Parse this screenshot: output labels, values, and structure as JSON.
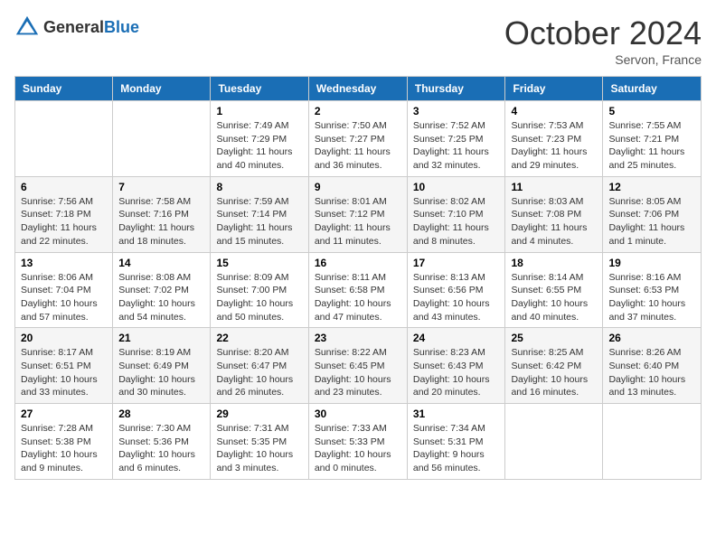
{
  "header": {
    "logo": {
      "text_general": "General",
      "text_blue": "Blue"
    },
    "title": "October 2024",
    "subtitle": "Servon, France"
  },
  "weekdays": [
    "Sunday",
    "Monday",
    "Tuesday",
    "Wednesday",
    "Thursday",
    "Friday",
    "Saturday"
  ],
  "weeks": [
    [
      {
        "day": "",
        "sunrise": "",
        "sunset": "",
        "daylight": ""
      },
      {
        "day": "",
        "sunrise": "",
        "sunset": "",
        "daylight": ""
      },
      {
        "day": "1",
        "sunrise": "Sunrise: 7:49 AM",
        "sunset": "Sunset: 7:29 PM",
        "daylight": "Daylight: 11 hours and 40 minutes."
      },
      {
        "day": "2",
        "sunrise": "Sunrise: 7:50 AM",
        "sunset": "Sunset: 7:27 PM",
        "daylight": "Daylight: 11 hours and 36 minutes."
      },
      {
        "day": "3",
        "sunrise": "Sunrise: 7:52 AM",
        "sunset": "Sunset: 7:25 PM",
        "daylight": "Daylight: 11 hours and 32 minutes."
      },
      {
        "day": "4",
        "sunrise": "Sunrise: 7:53 AM",
        "sunset": "Sunset: 7:23 PM",
        "daylight": "Daylight: 11 hours and 29 minutes."
      },
      {
        "day": "5",
        "sunrise": "Sunrise: 7:55 AM",
        "sunset": "Sunset: 7:21 PM",
        "daylight": "Daylight: 11 hours and 25 minutes."
      }
    ],
    [
      {
        "day": "6",
        "sunrise": "Sunrise: 7:56 AM",
        "sunset": "Sunset: 7:18 PM",
        "daylight": "Daylight: 11 hours and 22 minutes."
      },
      {
        "day": "7",
        "sunrise": "Sunrise: 7:58 AM",
        "sunset": "Sunset: 7:16 PM",
        "daylight": "Daylight: 11 hours and 18 minutes."
      },
      {
        "day": "8",
        "sunrise": "Sunrise: 7:59 AM",
        "sunset": "Sunset: 7:14 PM",
        "daylight": "Daylight: 11 hours and 15 minutes."
      },
      {
        "day": "9",
        "sunrise": "Sunrise: 8:01 AM",
        "sunset": "Sunset: 7:12 PM",
        "daylight": "Daylight: 11 hours and 11 minutes."
      },
      {
        "day": "10",
        "sunrise": "Sunrise: 8:02 AM",
        "sunset": "Sunset: 7:10 PM",
        "daylight": "Daylight: 11 hours and 8 minutes."
      },
      {
        "day": "11",
        "sunrise": "Sunrise: 8:03 AM",
        "sunset": "Sunset: 7:08 PM",
        "daylight": "Daylight: 11 hours and 4 minutes."
      },
      {
        "day": "12",
        "sunrise": "Sunrise: 8:05 AM",
        "sunset": "Sunset: 7:06 PM",
        "daylight": "Daylight: 11 hours and 1 minute."
      }
    ],
    [
      {
        "day": "13",
        "sunrise": "Sunrise: 8:06 AM",
        "sunset": "Sunset: 7:04 PM",
        "daylight": "Daylight: 10 hours and 57 minutes."
      },
      {
        "day": "14",
        "sunrise": "Sunrise: 8:08 AM",
        "sunset": "Sunset: 7:02 PM",
        "daylight": "Daylight: 10 hours and 54 minutes."
      },
      {
        "day": "15",
        "sunrise": "Sunrise: 8:09 AM",
        "sunset": "Sunset: 7:00 PM",
        "daylight": "Daylight: 10 hours and 50 minutes."
      },
      {
        "day": "16",
        "sunrise": "Sunrise: 8:11 AM",
        "sunset": "Sunset: 6:58 PM",
        "daylight": "Daylight: 10 hours and 47 minutes."
      },
      {
        "day": "17",
        "sunrise": "Sunrise: 8:13 AM",
        "sunset": "Sunset: 6:56 PM",
        "daylight": "Daylight: 10 hours and 43 minutes."
      },
      {
        "day": "18",
        "sunrise": "Sunrise: 8:14 AM",
        "sunset": "Sunset: 6:55 PM",
        "daylight": "Daylight: 10 hours and 40 minutes."
      },
      {
        "day": "19",
        "sunrise": "Sunrise: 8:16 AM",
        "sunset": "Sunset: 6:53 PM",
        "daylight": "Daylight: 10 hours and 37 minutes."
      }
    ],
    [
      {
        "day": "20",
        "sunrise": "Sunrise: 8:17 AM",
        "sunset": "Sunset: 6:51 PM",
        "daylight": "Daylight: 10 hours and 33 minutes."
      },
      {
        "day": "21",
        "sunrise": "Sunrise: 8:19 AM",
        "sunset": "Sunset: 6:49 PM",
        "daylight": "Daylight: 10 hours and 30 minutes."
      },
      {
        "day": "22",
        "sunrise": "Sunrise: 8:20 AM",
        "sunset": "Sunset: 6:47 PM",
        "daylight": "Daylight: 10 hours and 26 minutes."
      },
      {
        "day": "23",
        "sunrise": "Sunrise: 8:22 AM",
        "sunset": "Sunset: 6:45 PM",
        "daylight": "Daylight: 10 hours and 23 minutes."
      },
      {
        "day": "24",
        "sunrise": "Sunrise: 8:23 AM",
        "sunset": "Sunset: 6:43 PM",
        "daylight": "Daylight: 10 hours and 20 minutes."
      },
      {
        "day": "25",
        "sunrise": "Sunrise: 8:25 AM",
        "sunset": "Sunset: 6:42 PM",
        "daylight": "Daylight: 10 hours and 16 minutes."
      },
      {
        "day": "26",
        "sunrise": "Sunrise: 8:26 AM",
        "sunset": "Sunset: 6:40 PM",
        "daylight": "Daylight: 10 hours and 13 minutes."
      }
    ],
    [
      {
        "day": "27",
        "sunrise": "Sunrise: 7:28 AM",
        "sunset": "Sunset: 5:38 PM",
        "daylight": "Daylight: 10 hours and 9 minutes."
      },
      {
        "day": "28",
        "sunrise": "Sunrise: 7:30 AM",
        "sunset": "Sunset: 5:36 PM",
        "daylight": "Daylight: 10 hours and 6 minutes."
      },
      {
        "day": "29",
        "sunrise": "Sunrise: 7:31 AM",
        "sunset": "Sunset: 5:35 PM",
        "daylight": "Daylight: 10 hours and 3 minutes."
      },
      {
        "day": "30",
        "sunrise": "Sunrise: 7:33 AM",
        "sunset": "Sunset: 5:33 PM",
        "daylight": "Daylight: 10 hours and 0 minutes."
      },
      {
        "day": "31",
        "sunrise": "Sunrise: 7:34 AM",
        "sunset": "Sunset: 5:31 PM",
        "daylight": "Daylight: 9 hours and 56 minutes."
      },
      {
        "day": "",
        "sunrise": "",
        "sunset": "",
        "daylight": ""
      },
      {
        "day": "",
        "sunrise": "",
        "sunset": "",
        "daylight": ""
      }
    ]
  ]
}
